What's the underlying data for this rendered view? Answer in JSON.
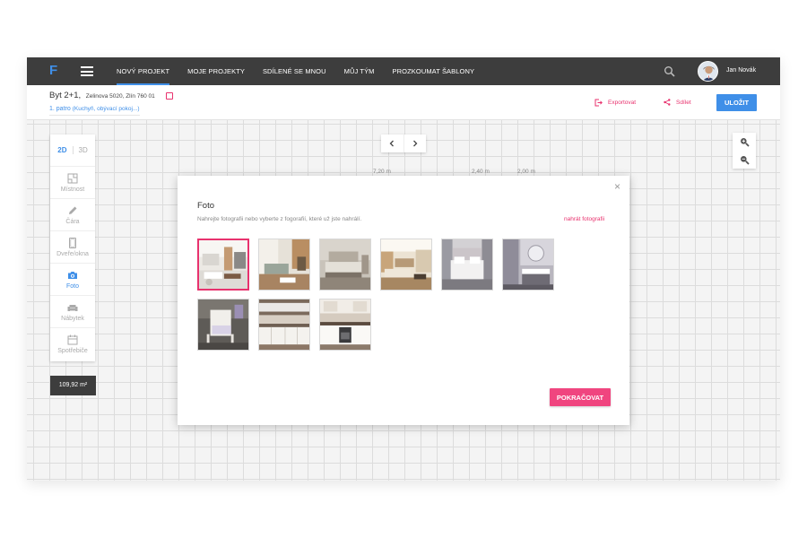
{
  "app": {
    "logo": "F",
    "username": "Jan Novák"
  },
  "nav": [
    {
      "label": "NOVÝ PROJEKT",
      "active": true
    },
    {
      "label": "MOJE PROJEKTY",
      "active": false
    },
    {
      "label": "SDÍLENÉ SE MNOU",
      "active": false
    },
    {
      "label": "MŮJ TÝM",
      "active": false
    },
    {
      "label": "PROZKOUMAT ŠABLONY",
      "active": false
    }
  ],
  "project": {
    "title": "Byt 2+1,",
    "address": "Zelinova 5020, Zlín 760 01",
    "floor": "1. patro",
    "floor_rooms": "(Kuchyň, obývací pokoj...)"
  },
  "actions": {
    "export_label": "Exportovat",
    "share_label": "Sdílet",
    "save_label": "ULOŽIT"
  },
  "toolbar": {
    "mode_2d": "2D",
    "mode_3d": "3D",
    "tools": [
      {
        "label": "Místnost",
        "icon": "room-icon",
        "active": false
      },
      {
        "label": "Čára",
        "icon": "pencil-icon",
        "active": false
      },
      {
        "label": "Dveře/okna",
        "icon": "door-icon",
        "active": false
      },
      {
        "label": "Foto",
        "icon": "camera-icon",
        "active": true
      },
      {
        "label": "Nábytek",
        "icon": "sofa-icon",
        "active": false
      },
      {
        "label": "Spotřebiče",
        "icon": "appliance-icon",
        "active": false
      }
    ]
  },
  "area": "109,92 m²",
  "dimensions": [
    "7,20 m",
    "2,40 m",
    "2,00 m"
  ],
  "modal": {
    "title": "Foto",
    "subtitle": "Nahrejte fotografii nebo vyberte z fogorafií, které už jste nahrálí.",
    "upload_label": "nahrát fotografii",
    "continue_label": "POKRAČOVAT",
    "close_symbol": "×",
    "selected_index": 0,
    "photo_count": 9
  },
  "colors": {
    "accent": "#3f8fe8",
    "pink": "#e8326e",
    "topbar": "#3d3d3d"
  }
}
